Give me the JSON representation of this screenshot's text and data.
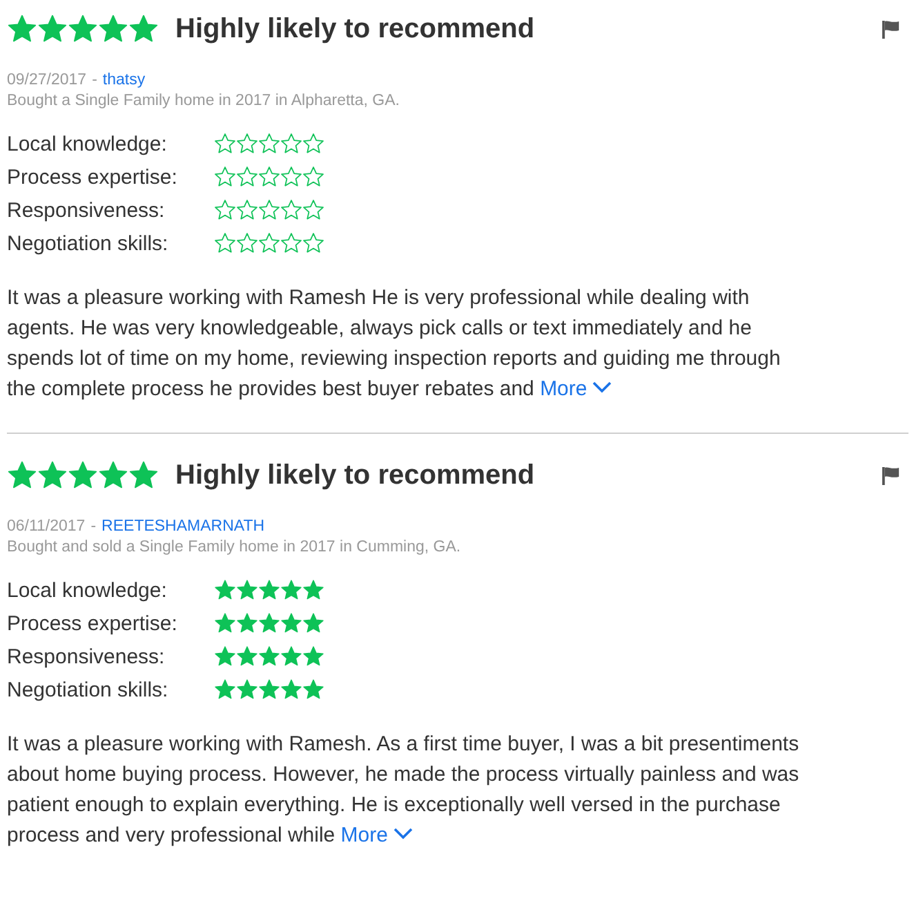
{
  "reviews": [
    {
      "stars": 5,
      "headline": "Highly likely to recommend",
      "date": "09/27/2017",
      "separator": "-",
      "author": "thatsy",
      "transaction": "Bought a Single Family home in 2017 in Alpharetta, GA.",
      "ratings": [
        {
          "label": "Local knowledge:",
          "stars": 0
        },
        {
          "label": "Process expertise:",
          "stars": 0
        },
        {
          "label": "Responsiveness:",
          "stars": 0
        },
        {
          "label": "Negotiation skills:",
          "stars": 0
        }
      ],
      "text": "It was a pleasure working with Ramesh He is very professional while dealing with agents. He was very knowledgeable, always pick calls or text immediately and he spends lot of time on my home, reviewing inspection reports and guiding me through the complete process he provides best buyer rebates and",
      "more": "More"
    },
    {
      "stars": 5,
      "headline": "Highly likely to recommend",
      "date": "06/11/2017",
      "separator": "-",
      "author": "REETESHAMARNATH",
      "transaction": "Bought and sold a Single Family home in 2017 in Cumming, GA.",
      "ratings": [
        {
          "label": "Local knowledge:",
          "stars": 5
        },
        {
          "label": "Process expertise:",
          "stars": 5
        },
        {
          "label": "Responsiveness:",
          "stars": 5
        },
        {
          "label": "Negotiation skills:",
          "stars": 5
        }
      ],
      "text": "It was a pleasure working with Ramesh. As a first time buyer, I was a bit presentiments about home buying process. However, he made the process virtually painless and was patient enough to explain everything. He is exceptionally well versed in the purchase process and very professional while",
      "more": "More"
    }
  ]
}
